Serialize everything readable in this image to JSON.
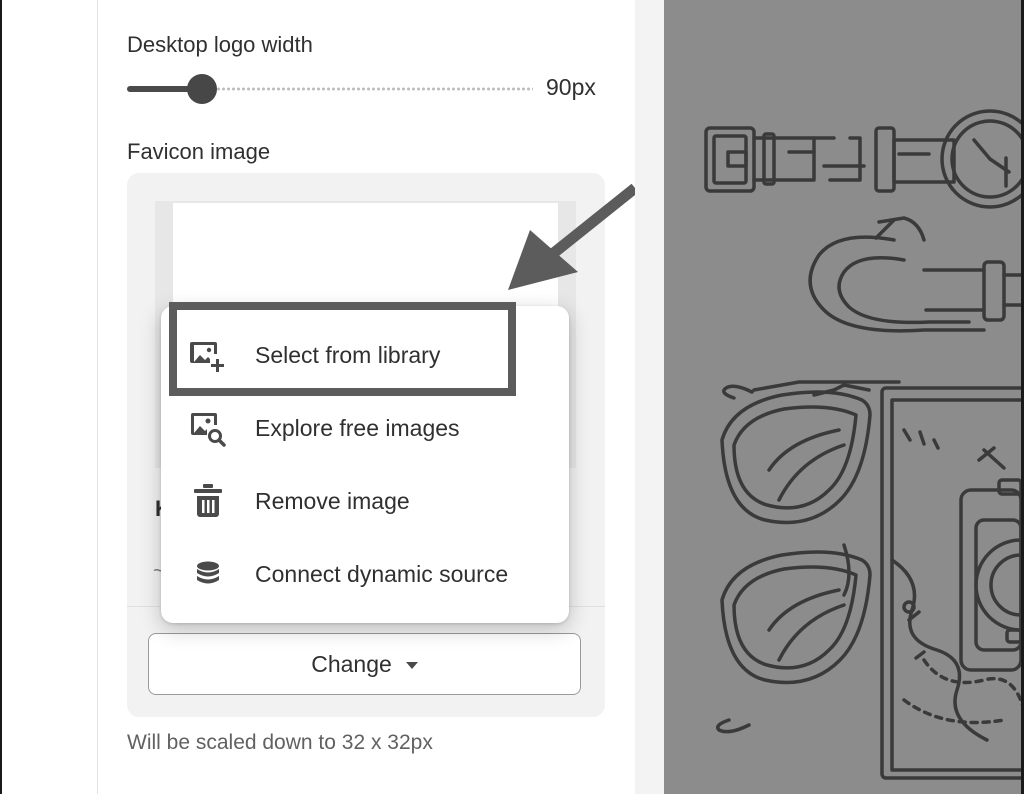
{
  "settings": {
    "logo_width": {
      "label": "Desktop logo width",
      "value_text": "90px",
      "level_fraction": 0.185
    },
    "favicon": {
      "label": "Favicon image",
      "change_button_label": "Change",
      "help_text": "Will be scaled down to 32 x 32px",
      "obscured_label_initial": "K",
      "obscured_tick": "~"
    }
  },
  "menu": {
    "items": [
      {
        "label": "Select from library",
        "icon": "image-add-icon"
      },
      {
        "label": "Explore free images",
        "icon": "image-search-icon"
      },
      {
        "label": "Remove image",
        "icon": "trash-icon"
      },
      {
        "label": "Connect dynamic source",
        "icon": "database-icon"
      }
    ],
    "highlighted_index": 0
  },
  "colors": {
    "preview_background": "#8c8c8c",
    "annotation": "#5c5c5c",
    "line_art": "#3a3a3a"
  }
}
